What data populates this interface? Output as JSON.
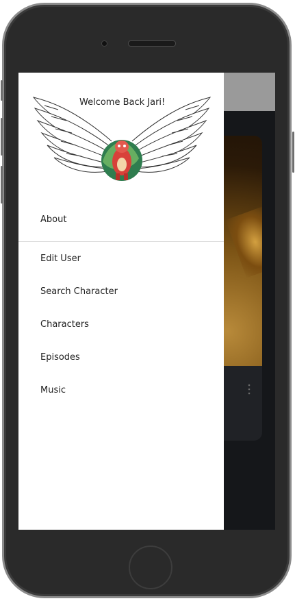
{
  "drawer": {
    "welcome_text": "Welcome Back Jari!",
    "logo_icon": "winged-character-logo",
    "about_label": "About",
    "items": [
      {
        "label": "Edit User"
      },
      {
        "label": "Search Character"
      },
      {
        "label": "Characters"
      },
      {
        "label": "Episodes"
      },
      {
        "label": "Music"
      }
    ]
  },
  "background_app": {
    "overflow_icon": "kebab-menu-icon"
  },
  "colors": {
    "drawer_bg": "#ffffff",
    "scrim": "#15171a",
    "appbar": "#9a9a9a",
    "phone_frame": "#2a2a2a"
  }
}
